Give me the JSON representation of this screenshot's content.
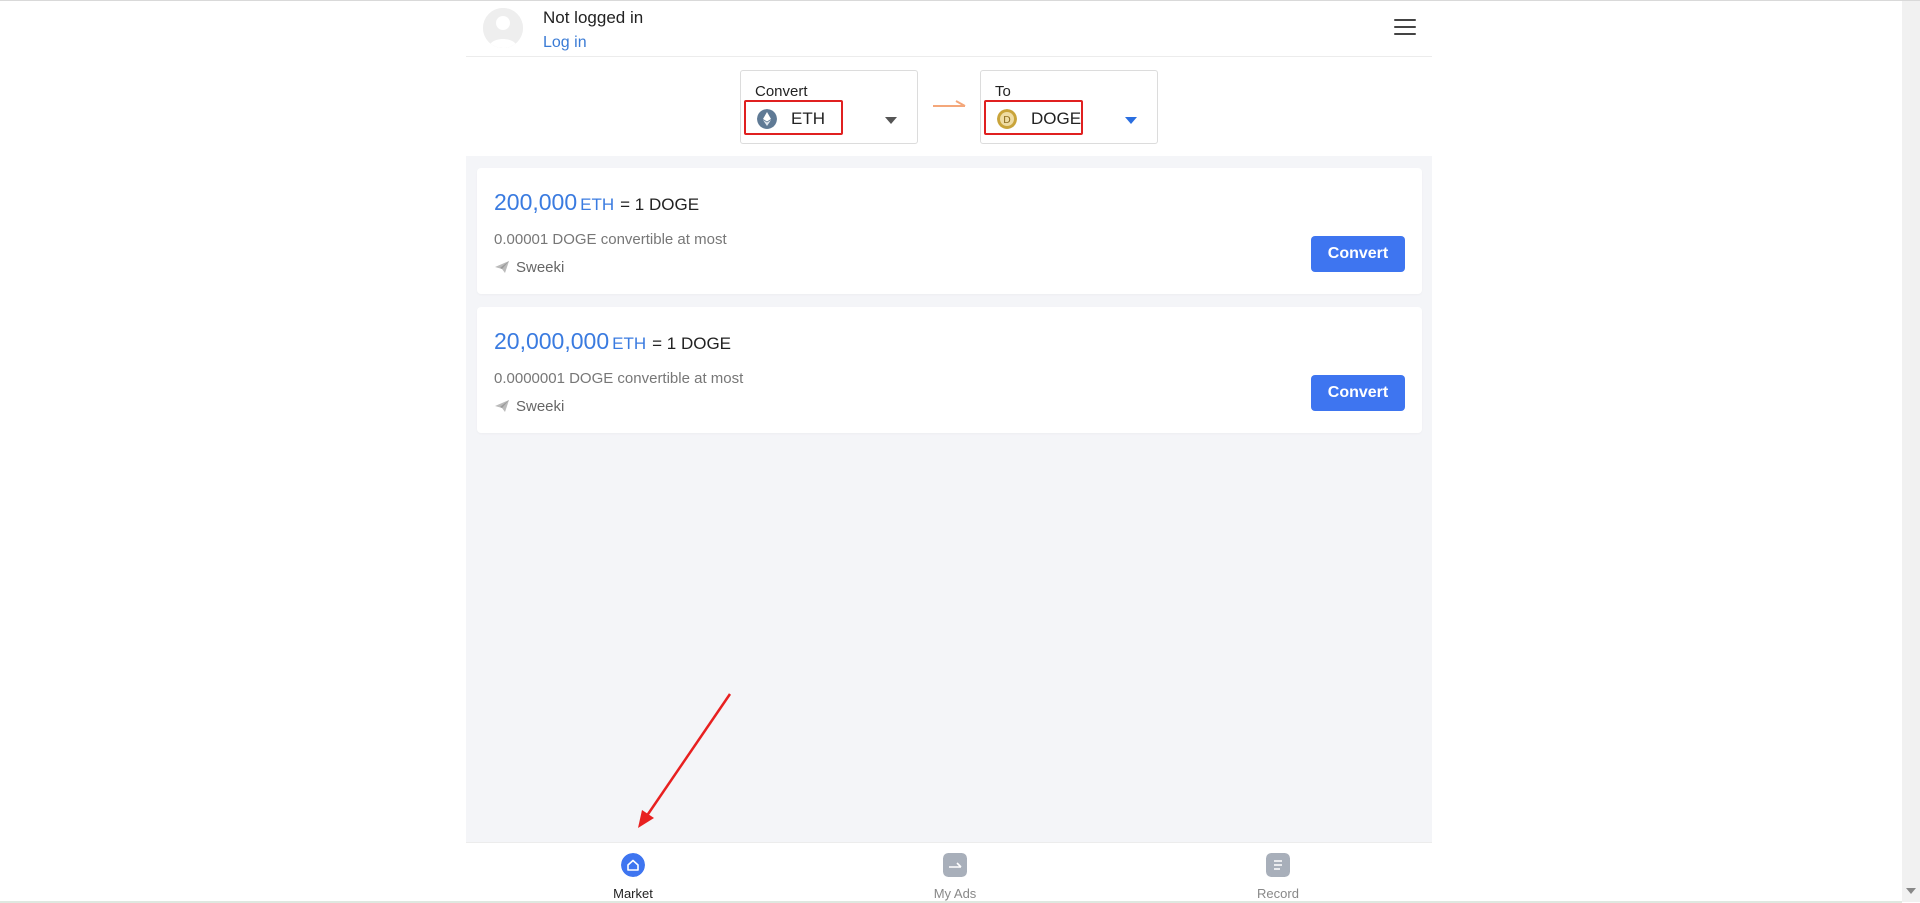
{
  "header": {
    "user_name": "Not logged in",
    "login_label": "Log in"
  },
  "selector": {
    "from": {
      "label": "Convert",
      "coin": "ETH",
      "icon": "eth-coin-icon"
    },
    "to": {
      "label": "To",
      "coin": "DOGE",
      "icon": "doge-coin-icon"
    }
  },
  "offers": [
    {
      "amount": "200,000",
      "unit": "ETH",
      "equals": "= 1 DOGE",
      "limit": "0.00001 DOGE convertible at most",
      "seller": "Sweeki",
      "button": "Convert"
    },
    {
      "amount": "20,000,000",
      "unit": "ETH",
      "equals": "= 1 DOGE",
      "limit": "0.0000001 DOGE convertible at most",
      "seller": "Sweeki",
      "button": "Convert"
    }
  ],
  "tabs": [
    {
      "label": "Market",
      "active": true
    },
    {
      "label": "My Ads",
      "active": false
    },
    {
      "label": "Record",
      "active": false
    }
  ],
  "colors": {
    "accent": "#3e75f0",
    "highlight_box": "#e02020",
    "annotation_arrow": "#e82020"
  }
}
